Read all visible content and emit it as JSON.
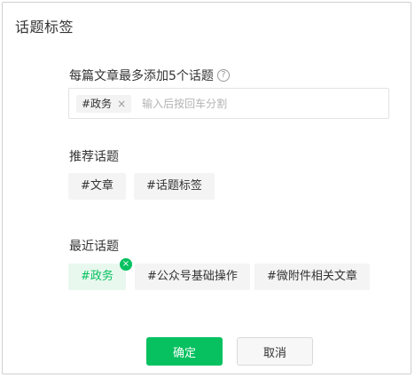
{
  "dialog": {
    "title": "话题标签"
  },
  "field": {
    "label": "每篇文章最多添加5个话题",
    "help_icon": "?",
    "input": {
      "chips": [
        {
          "label": "#政务",
          "close": "×"
        }
      ],
      "placeholder": "输入后按回车分割"
    }
  },
  "recommended": {
    "title": "推荐话题",
    "tags": [
      "#文章",
      "#话题标签"
    ]
  },
  "recent": {
    "title": "最近话题",
    "tags": [
      {
        "label": "#政务",
        "selected": true,
        "remove": "×"
      },
      {
        "label": "#公众号基础操作",
        "selected": false
      },
      {
        "label": "#微附件相关文章",
        "selected": false
      }
    ]
  },
  "actions": {
    "confirm": "确定",
    "cancel": "取消"
  },
  "colors": {
    "accent": "#07c160",
    "accent_bg": "#e8f8ee",
    "chip_bg": "#f4f4f4"
  }
}
